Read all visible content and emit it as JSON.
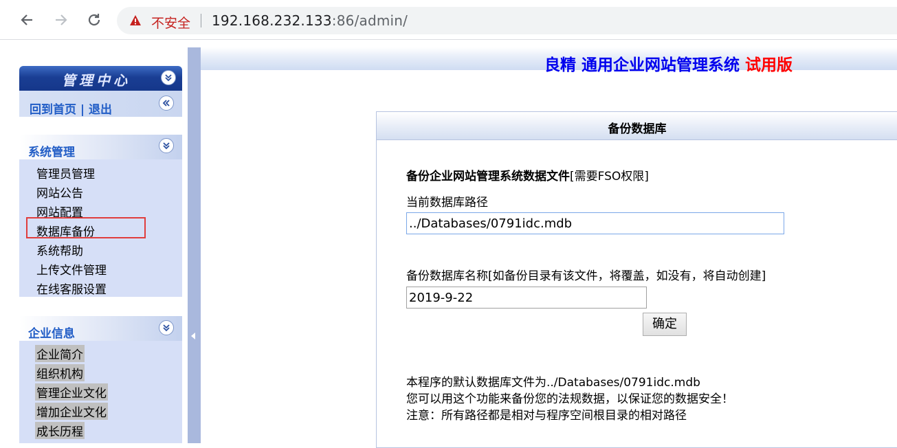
{
  "browser": {
    "security_label": "不安全",
    "url_host": "192.168.232.133",
    "url_port": ":86",
    "url_path": "/admin/",
    "icons": {
      "back": "back-arrow-icon",
      "forward": "forward-arrow-icon",
      "reload": "reload-icon",
      "warning": "warning-triangle-icon"
    }
  },
  "sidebar": {
    "header_title": "管理中心",
    "home_logout": "回到首页 | 退出",
    "sections": [
      {
        "title": "系统管理",
        "items": [
          "管理员管理",
          "网站公告",
          "网站配置",
          "数据库备份",
          "系统帮助",
          "上传文件管理",
          "在线客服设置"
        ]
      },
      {
        "title": "企业信息",
        "items": [
          "企业简介",
          "组织机构",
          "管理企业文化",
          "增加企业文化",
          "成长历程"
        ]
      }
    ],
    "selected_item": "数据库备份"
  },
  "main": {
    "title_brand": "良精 通用企业网站管理系统",
    "title_trial": "试用版",
    "panel_title": "备份数据库",
    "backup_heading_bold": "备份企业网站管理系统数据文件",
    "backup_heading_note": "[需要FSO权限]",
    "current_path_label": "当前数据库路径",
    "current_path_value": "../Databases/0791idc.mdb",
    "backup_name_label": "备份数据库名称[如备份目录有该文件，将覆盖，如没有，将自动创建]",
    "backup_name_value": "2019-9-22",
    "confirm_button": "确定",
    "note_lines": [
      "本程序的默认数据库文件为../Databases/0791idc.mdb",
      "您可以用这个功能来备份您的法规数据，以保证您的数据安全！",
      "注意：所有路径都是相对与程序空间根目录的相对路径"
    ]
  },
  "colors": {
    "accent_blue": "#215dc6",
    "title_blue": "#0000ee",
    "trial_red": "#ff0000",
    "sidebar_bg": "#d6dff7",
    "splitter": "#a9b8dd",
    "highlight_box": "#e03c3c"
  }
}
